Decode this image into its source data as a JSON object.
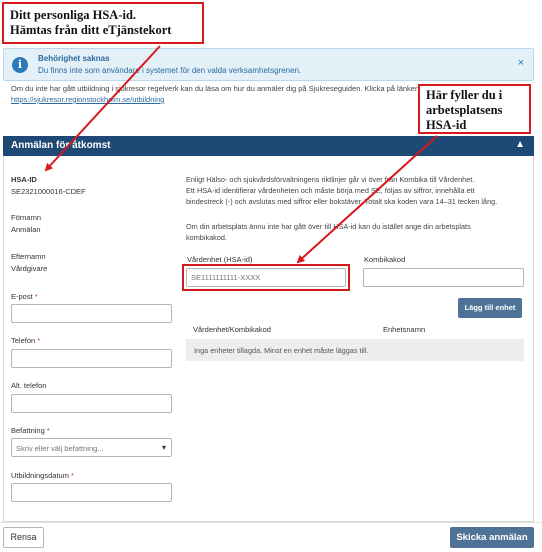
{
  "callouts": {
    "hsa_line1": "Ditt personliga HSA-id.",
    "hsa_line2": "Hämtas från ditt eTjänstekort",
    "work_line1": "Här fyller du i",
    "work_line2": "arbetsplatsens",
    "work_line3": "HSA-id"
  },
  "alert": {
    "title": "Behörighet saknas",
    "text": "Du finns inte som användare i systemet för den valda verksamhetsgrenen.",
    "close": "×",
    "icon": "info-icon"
  },
  "info": {
    "line": "Om du inte har gått utbildning i sjukresor regelverk kan du läsa om hur du anmäler dig på Sjukreseguiden. Klicka på länken",
    "link": "https://sjukresor.regionstockholm.se/utbildning"
  },
  "panel": {
    "title": "Anmälan för åtkomst",
    "caret": "▲"
  },
  "user": {
    "hsa_label": "HSA-ID",
    "hsa_value": "SE2321000016-CDEF",
    "firstname_label": "Förnamn",
    "firstname_value": "Anmälan",
    "lastname_label": "Efternamn",
    "lastname_value": "Vårdgivare",
    "email_label": "E-post",
    "phone_label": "Telefon",
    "alt_phone_label": "Alt. telefon",
    "position_label": "Befattning",
    "position_placeholder": "Skriv eller välj befattning...",
    "education_label": "Utbildningsdatum",
    "required_mark": "*"
  },
  "description": {
    "line1": "Enligt Hälso- och sjukvårdsförvaltningens riktlinjer går vi över från Kombika till Vårdenhet.",
    "line2": "Ett HSA-id identifierar vårdenheten och måste börja med SE, följas av siffror, innehålla ett",
    "line3": "bindestreck (-) och avslutas med siffror eller bokstäver. Totalt ska koden vara 14–31 tecken lång.",
    "line4": "Om din arbetsplats ännu inte har gått över till HSA-id kan du istället ange din arbetsplats",
    "line5": "kombikakod."
  },
  "unit": {
    "vardenhet_label": "Vårdenhet (HSA-id)",
    "vardenhet_placeholder": "SE1111111111-XXXX",
    "kombikakod_label": "Kombikakod",
    "add_button": "Lägg till enhet"
  },
  "table": {
    "col1": "Vårdenhet/Kombikakod",
    "col2": "Enhetsnamn",
    "empty": "Inga enheter tillagda. Minst en enhet måste läggas till."
  },
  "footer": {
    "reset": "Rensa",
    "submit": "Skicka anmälan"
  },
  "colors": {
    "header": "#1f4975",
    "button": "#4f7397",
    "callout_border": "#d6191c",
    "alert_bg": "#e3f0f8"
  }
}
